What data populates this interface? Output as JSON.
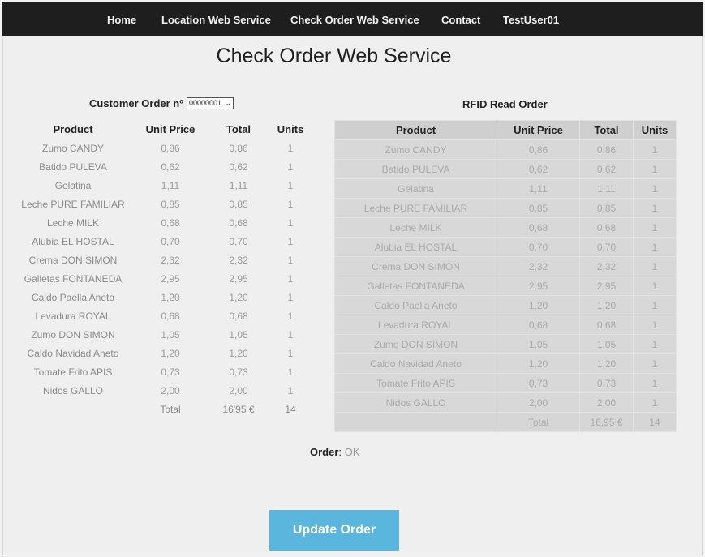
{
  "nav": {
    "items": [
      {
        "label": "Home"
      },
      {
        "label": "Location Web Service"
      },
      {
        "label": "Check Order Web Service"
      },
      {
        "label": "Contact"
      },
      {
        "label": "TestUser01"
      }
    ]
  },
  "page": {
    "title": "Check Order Web Service"
  },
  "left_panel": {
    "header_label": "Customer Order nº",
    "selected_order": "00000001",
    "columns": [
      "Product",
      "Unit Price",
      "Total",
      "Units"
    ],
    "rows": [
      [
        "Zumo CANDY",
        "0,86",
        "0,86",
        "1"
      ],
      [
        "Batido PULEVA",
        "0,62",
        "0,62",
        "1"
      ],
      [
        "Gelatina",
        "1,11",
        "1,11",
        "1"
      ],
      [
        "Leche PURE FAMILIAR",
        "0,85",
        "0,85",
        "1"
      ],
      [
        "Leche MILK",
        "0,68",
        "0,68",
        "1"
      ],
      [
        "Alubia EL HOSTAL",
        "0,70",
        "0,70",
        "1"
      ],
      [
        "Crema DON SIMON",
        "2,32",
        "2,32",
        "1"
      ],
      [
        "Galletas FONTANEDA",
        "2,95",
        "2,95",
        "1"
      ],
      [
        "Caldo Paella Aneto",
        "1,20",
        "1,20",
        "1"
      ],
      [
        "Levadura ROYAL",
        "0,68",
        "0,68",
        "1"
      ],
      [
        "Zumo DON SIMON",
        "1,05",
        "1,05",
        "1"
      ],
      [
        "Caldo Navidad Aneto",
        "1,20",
        "1,20",
        "1"
      ],
      [
        "Tomate Frito APIS",
        "0,73",
        "0,73",
        "1"
      ],
      [
        "Nidos GALLO",
        "2,00",
        "2,00",
        "1"
      ]
    ],
    "totals": {
      "label": "Total",
      "amount": "16'95 €",
      "units": "14"
    }
  },
  "right_panel": {
    "header_label": "RFID Read Order",
    "columns": [
      "Product",
      "Unit Price",
      "Total",
      "Units"
    ],
    "rows": [
      [
        "Zumo CANDY",
        "0,86",
        "0,86",
        "1"
      ],
      [
        "Batido PULEVA",
        "0,62",
        "0,62",
        "1"
      ],
      [
        "Gelatina",
        "1,11",
        "1,11",
        "1"
      ],
      [
        "Leche PURE FAMILIAR",
        "0,85",
        "0,85",
        "1"
      ],
      [
        "Leche MILK",
        "0,68",
        "0,68",
        "1"
      ],
      [
        "Alubia EL HOSTAL",
        "0,70",
        "0,70",
        "1"
      ],
      [
        "Crema DON SIMON",
        "2,32",
        "2,32",
        "1"
      ],
      [
        "Galletas FONTANEDA",
        "2,95",
        "2,95",
        "1"
      ],
      [
        "Caldo Paella Aneto",
        "1,20",
        "1,20",
        "1"
      ],
      [
        "Levadura ROYAL",
        "0,68",
        "0,68",
        "1"
      ],
      [
        "Zumo DON SIMON",
        "1,05",
        "1,05",
        "1"
      ],
      [
        "Caldo Navidad Aneto",
        "1,20",
        "1,20",
        "1"
      ],
      [
        "Tomate Frito APIS",
        "0,73",
        "0,73",
        "1"
      ],
      [
        "Nidos GALLO",
        "2,00",
        "2,00",
        "1"
      ]
    ],
    "totals": {
      "label": "Total",
      "amount": "16,95 €",
      "units": "14"
    }
  },
  "status": {
    "label": "Order",
    "value": "OK"
  },
  "actions": {
    "update_label": "Update Order"
  },
  "colors": {
    "navbar": "#1e1e1e",
    "button": "#5ab6dc",
    "table_bg": "#d8d8d8"
  }
}
